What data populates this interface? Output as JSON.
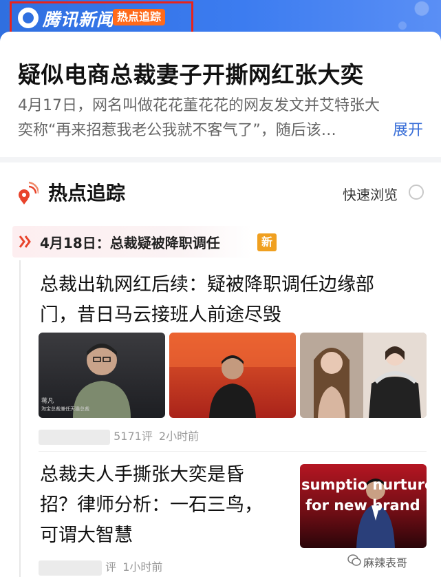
{
  "header": {
    "brand_name": "腾讯新闻",
    "brand_tag": "热点追踪",
    "icons": [
      "tencent-news-logo",
      "decorative-dots"
    ]
  },
  "article": {
    "headline": "疑似电商总裁妻子开撕网红张大奕",
    "summary_lines": [
      "4月17日，网名叫做花花董花花的网友发文并艾特张大",
      "奕称“再来招惹我老公我就不客气了”，随后该…"
    ],
    "expand_label": "展开"
  },
  "hot_tracking": {
    "section_title": "热点追踪",
    "quick_browse_label": "快速浏览",
    "date_label": "4月18日：总裁疑被降职调任",
    "new_badge": "新",
    "items": [
      {
        "title_lines": [
          "总裁出轨网红后续：疑被降职调任边缘部",
          "门，昔日马云接班人前途尽毁"
        ],
        "thumb_caption_1": "蒋凡",
        "thumb_caption_2": "淘宝总裁兼任天猫总裁",
        "comments": "5171评",
        "time": "2小时前"
      },
      {
        "title_lines": [
          "总裁夫人手撕张大奕是昏",
          "招？律师分析：一石三鸟，",
          "可谓大智慧"
        ],
        "thumb_text_1": "sumptio nurture",
        "thumb_text_2": "for new brand",
        "comments": "评",
        "time": "1小时前"
      }
    ]
  },
  "watermark": "麻辣表哥",
  "colors": {
    "header_blue": "#2f6fe0",
    "highlight_red": "#e8231b",
    "tag_orange": "#ff6a1a",
    "link_blue": "#3a6fd8",
    "new_badge": "#f0a020"
  }
}
